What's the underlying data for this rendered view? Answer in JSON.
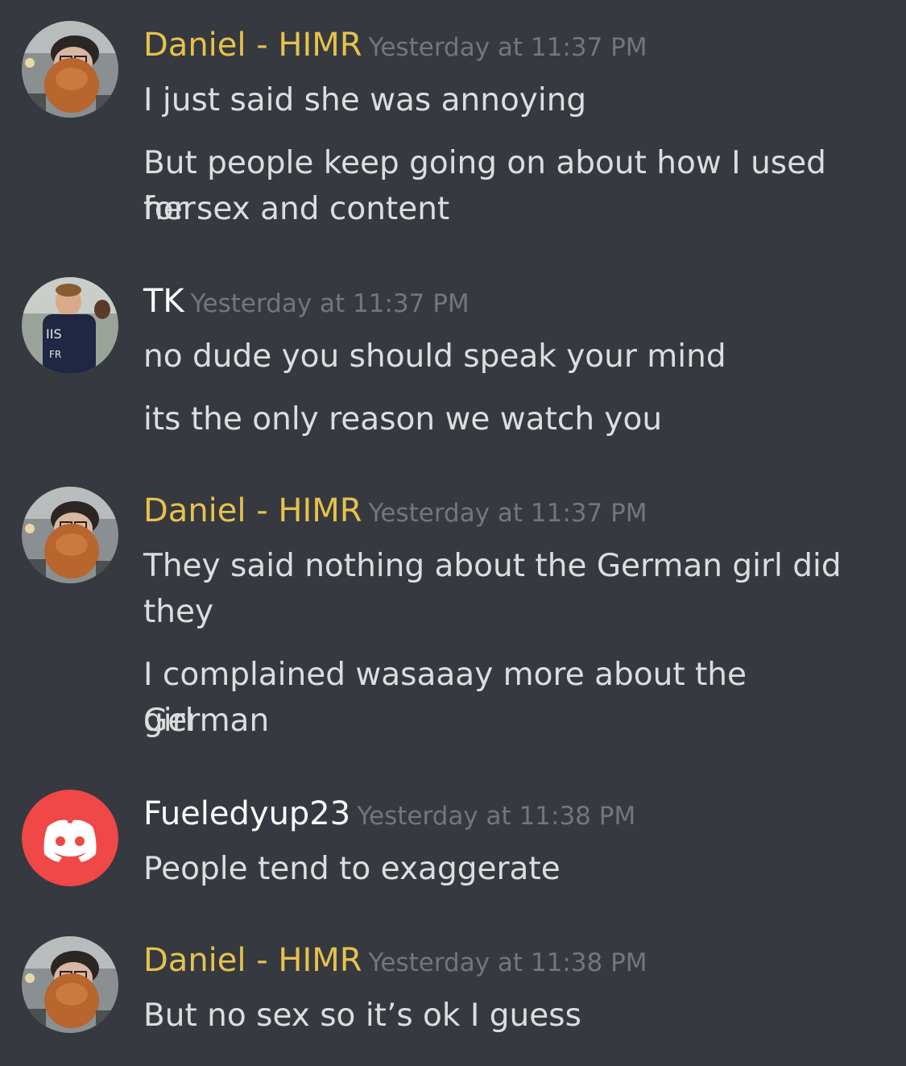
{
  "colors": {
    "background": "#36393f",
    "daniel_name": "#e6c24c",
    "default_name": "#ffffff",
    "timestamp": "#72767d",
    "message_text": "#dcddde",
    "discord_red": "#f04747"
  },
  "messages": [
    {
      "author": "Daniel - HIMR",
      "timestamp": "Yesterday at 11:37 PM",
      "avatar": "bearded-man-avatar",
      "lines": [
        "I just said she was annoying",
        "But people keep going on about how I used her",
        "for sex and content"
      ]
    },
    {
      "author": "TK",
      "timestamp": "Yesterday at 11:37 PM",
      "avatar": "child-photo-avatar",
      "lines": [
        "no dude you should speak your mind",
        "its the only reason we watch you"
      ]
    },
    {
      "author": "Daniel - HIMR",
      "timestamp": "Yesterday at 11:37 PM",
      "avatar": "bearded-man-avatar",
      "lines": [
        "They said nothing about the German girl did",
        "they",
        "I complained wasaaay more about the German",
        "girl"
      ]
    },
    {
      "author": "Fueledyup23",
      "timestamp": "Yesterday at 11:38 PM",
      "avatar": "discord-default-avatar",
      "lines": [
        "People tend to exaggerate"
      ]
    },
    {
      "author": "Daniel - HIMR",
      "timestamp": "Yesterday at 11:38 PM",
      "avatar": "bearded-man-avatar",
      "lines": [
        "But no sex so it’s ok I guess"
      ]
    }
  ]
}
